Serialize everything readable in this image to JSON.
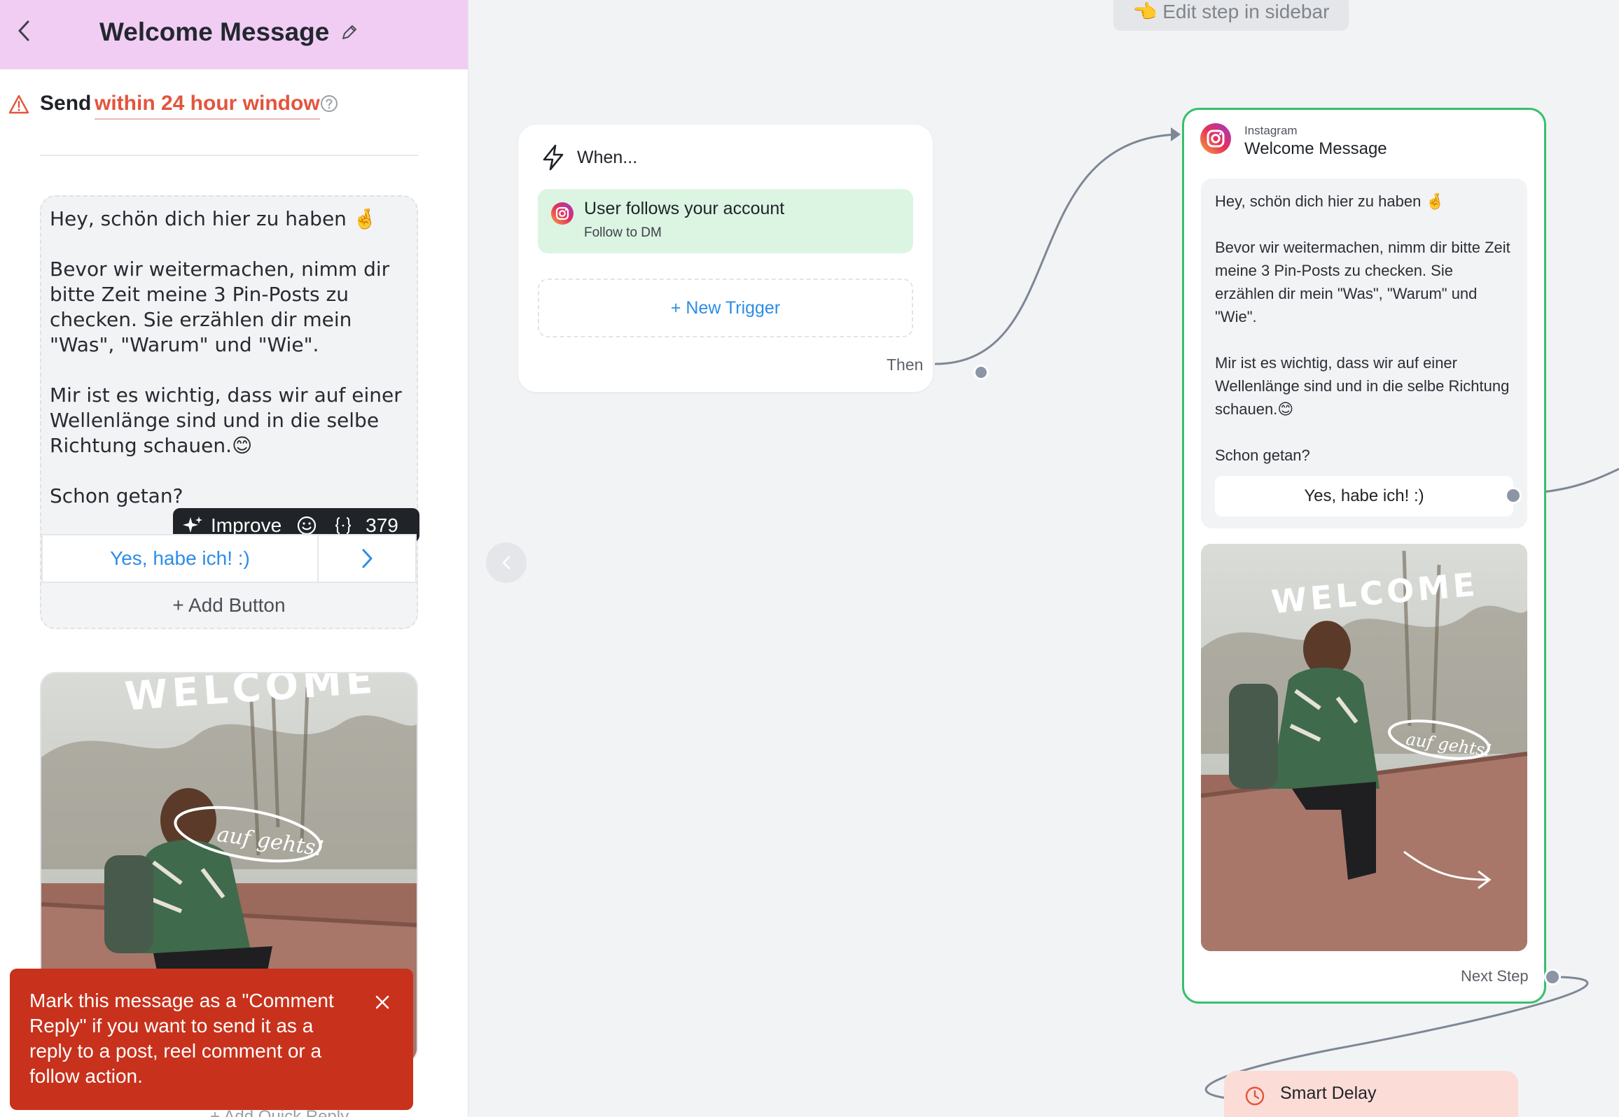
{
  "sidebar": {
    "title": "Welcome Message",
    "send_label": "Send",
    "send_window": "within 24 hour window",
    "message_text": "Hey, schön dich hier zu haben 🤞\n\nBevor wir weitermachen, nimm dir bitte Zeit meine 3 Pin-Posts zu checken. Sie erzählen dir mein \"Was\", \"Warum\" und \"Wie\".\n\nMir ist es wichtig, dass wir auf einer Wellenlänge sind und in die selbe Richtung schauen.😊\n\nSchon getan?",
    "toolbar": {
      "improve_label": "Improve",
      "char_count": "379"
    },
    "quick_button_label": "Yes, habe ich! :)",
    "add_button_label": "+ Add Button",
    "toast_text": "Mark this message as a \"Comment Reply\" if you want to send it as a reply to a post, reel comment or a follow action.",
    "add_quick_reply_label": "+ Add Quick Reply"
  },
  "canvas": {
    "hint": "👈 Edit step in sidebar",
    "trigger_node": {
      "heading": "When...",
      "trigger_title": "User follows your account",
      "trigger_subtitle": "Follow to DM",
      "new_trigger_label": "+ New Trigger",
      "then_label": "Then"
    },
    "message_node": {
      "platform": "Instagram",
      "title": "Welcome Message",
      "text": "Hey, schön dich hier zu haben 🤞\n\nBevor wir weitermachen, nimm dir bitte Zeit meine 3 Pin-Posts zu checken. Sie erzählen dir mein \"Was\", \"Warum\" und \"Wie\".\n\nMir ist es wichtig, dass wir auf einer Wellenlänge sind und in die selbe Richtung schauen.😊\n\nSchon getan?",
      "button_label": "Yes, habe ich! :)",
      "next_step_label": "Next Step"
    },
    "delay_node": {
      "label": "Smart Delay"
    }
  },
  "image_text": {
    "welcome": "WELCOME",
    "caption": "auf gehts!"
  },
  "colors": {
    "header_bg": "#f2cdf3",
    "warning": "#e2553d",
    "link_blue": "#2d8de6",
    "node_border": "#37c06b",
    "trigger_bg": "#dcf5e3",
    "toast_bg": "#c8311c",
    "delay_bg": "#fcdcd6"
  },
  "icons": {
    "back": "chevron-left-icon",
    "edit": "pencil-icon",
    "warning": "warning-triangle-icon",
    "help": "question-circle-icon",
    "improve": "sparkles-icon",
    "emoji": "smiley-icon",
    "variable": "braces-icon",
    "trigger": "lightning-icon",
    "platform": "instagram-icon",
    "delay": "clock-icon"
  }
}
